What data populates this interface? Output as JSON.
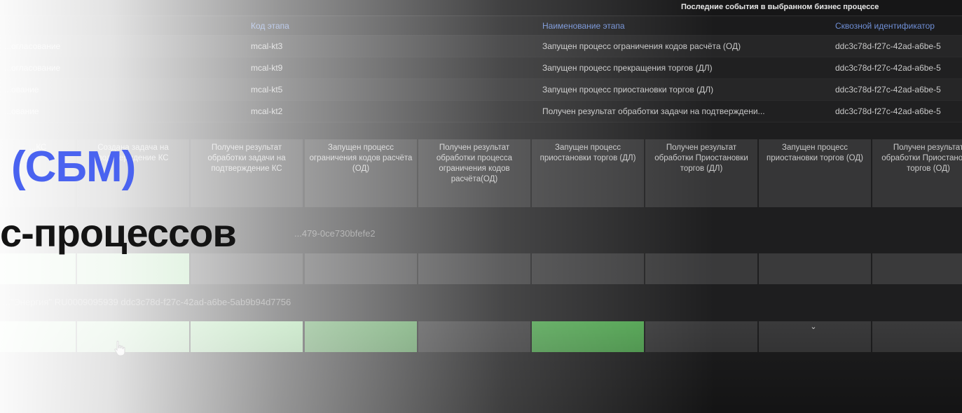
{
  "header": {
    "panel_title": "Последние события в выбранном бизнес процессе"
  },
  "events_table": {
    "columns": [
      "Код этапа",
      "Наименование этапа",
      "Сквозной идентификатор"
    ],
    "rows": [
      {
        "status": "...огласование",
        "code": "mcal-kt3",
        "name": "Запущен процесс ограничения кодов расчёта (ОД)",
        "id": "ddc3c78d-f27c-42ad-a6be-5"
      },
      {
        "status": "...огласование",
        "code": "mcal-kt9",
        "name": "Запущен процесс прекращения торгов (ДЛ)",
        "id": "ddc3c78d-f27c-42ad-a6be-5"
      },
      {
        "status": "...ование",
        "code": "mcal-kt5",
        "name": "Запущен процесс приостановки торгов (ДЛ)",
        "id": "ddc3c78d-f27c-42ad-a6be-5"
      },
      {
        "status": "...ование",
        "code": "mcal-kt2",
        "name": "Получен результат обработки задачи на подтверждени...",
        "id": "ddc3c78d-f27c-42ad-a6be-5"
      }
    ]
  },
  "stages": [
    "...КС",
    "Создана задача на подтверждение КС",
    "Получен результат обработки задачи на подтверждение КС",
    "Запущен процесс ограничения кодов расчёта (ОД)",
    "Получен результат обработки процесса ограничения кодов расчёта(ОД)",
    "Запущен процесс приостановки торгов (ДЛ)",
    "Получен результат обработки Приостановки торгов (ДЛ)",
    "Запущен процесс приостановки торгов (ОД)",
    "Получен результат обработки Приостановки торгов (ОД)"
  ],
  "processes": [
    {
      "label": "...479-0ce730bfefe2",
      "states": [
        "light",
        "light",
        "empty",
        "empty",
        "empty",
        "empty",
        "empty",
        "empty",
        "empty"
      ]
    },
    {
      "label": "...\"Энергия\" RU0009095939 ddc3c78d-f27c-42ad-a6be-5ab9b94d7756",
      "states": [
        "light",
        "light",
        "light",
        "done",
        "empty",
        "bright",
        "empty",
        "empty",
        "empty"
      ]
    }
  ],
  "headline": {
    "line1": "(СБМ)",
    "line2": "с-процессов"
  },
  "colors": {
    "accent": "#4a63f0",
    "table_header": "#6f8fd6",
    "cell_done": "#5f9f5f",
    "cell_light": "#9ed79e",
    "cell_bright": "#4fa24f",
    "cell_empty": "#3a3a3b"
  }
}
